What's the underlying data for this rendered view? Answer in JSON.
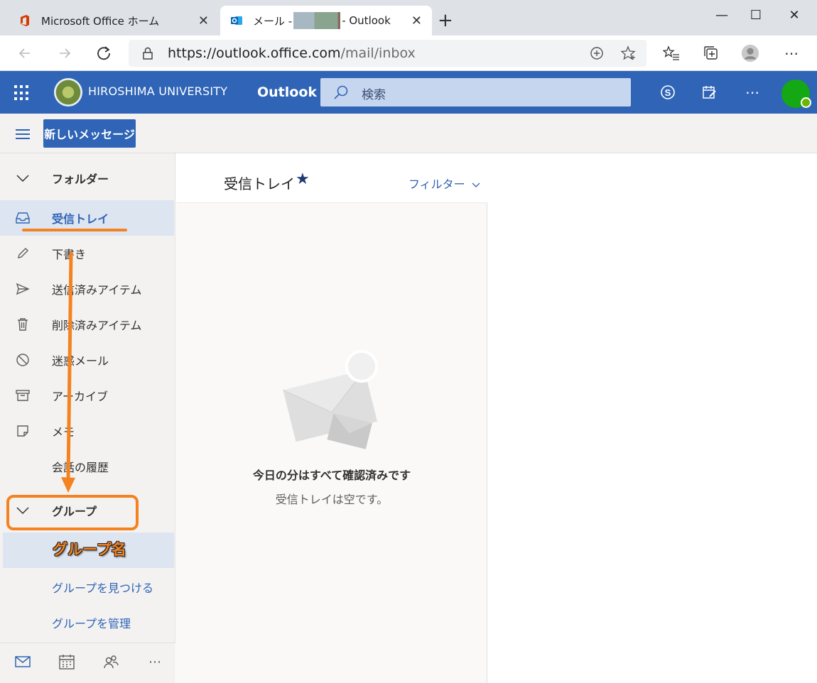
{
  "browser": {
    "tabs": [
      {
        "title": "Microsoft Office ホーム",
        "close": "✕"
      },
      {
        "title_prefix": "メール - ",
        "title_suffix": " - Outlook",
        "close": "✕"
      }
    ],
    "new_tab": "+",
    "window_controls": {
      "minimize": "—",
      "maximize": "☐",
      "close": "✕"
    },
    "url": {
      "host": "https://outlook.office.com",
      "path": "/mail/inbox"
    },
    "icons": [
      "back-icon",
      "forward-icon",
      "refresh-icon",
      "lock-icon",
      "add-icon",
      "favorite-star-icon",
      "favorites-list-icon",
      "collections-icon",
      "profile-icon",
      "more-icon"
    ]
  },
  "header": {
    "university": "HIROSHIMA UNIVERSITY",
    "app_name": "Outlook",
    "search_placeholder": "検索"
  },
  "toolbar": {
    "new_message": "新しいメッセージ"
  },
  "sidebar": {
    "folders_header": "フォルダー",
    "items": [
      {
        "label": "受信トレイ",
        "icon": "inbox-icon",
        "selected": true
      },
      {
        "label": "下書き",
        "icon": "pencil-icon"
      },
      {
        "label": "送信済みアイテム",
        "icon": "send-icon"
      },
      {
        "label": "削除済みアイテム",
        "icon": "trash-icon"
      },
      {
        "label": "迷惑メール",
        "icon": "block-icon"
      },
      {
        "label": "アーカイブ",
        "icon": "archive-icon"
      },
      {
        "label": "メモ",
        "icon": "note-icon"
      },
      {
        "label": "会話の履歴",
        "icon": ""
      }
    ],
    "groups_header": "グループ",
    "group_name": "グループ名",
    "find_groups": "グループを見つける",
    "manage_groups": "グループを管理"
  },
  "message_list": {
    "title": "受信トレイ",
    "star": "★",
    "filter": "フィルター",
    "empty_title": "今日の分はすべて確認済みです",
    "empty_sub": "受信トレイは空です。"
  },
  "colors": {
    "accent": "#2f64b6",
    "annotation": "#f58220",
    "presence": "#6bb700"
  }
}
